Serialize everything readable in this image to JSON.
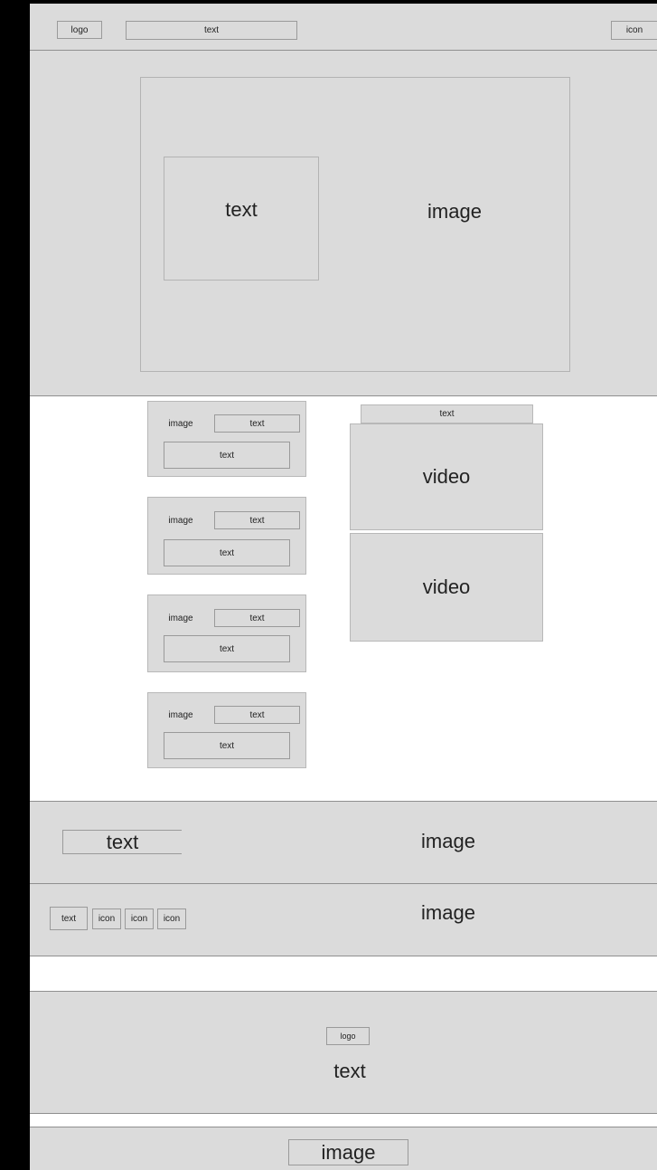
{
  "header": {
    "logo": "logo",
    "text": "text",
    "icon": "icon"
  },
  "hero": {
    "text": "text",
    "image": "image"
  },
  "cards": [
    {
      "image": "image",
      "tag": "text",
      "text": "text"
    },
    {
      "image": "image",
      "tag": "text",
      "text": "text"
    },
    {
      "image": "image",
      "tag": "text",
      "text": "text"
    },
    {
      "image": "image",
      "tag": "text",
      "text": "text"
    }
  ],
  "video_panel": {
    "title": "text",
    "videos": [
      "video",
      "video"
    ]
  },
  "banner": {
    "text": "text",
    "image": "image"
  },
  "social": {
    "text": "text",
    "icons": [
      "icon",
      "icon",
      "icon"
    ],
    "image": "image"
  },
  "footer": {
    "logo": "logo",
    "text": "text"
  },
  "bottom": {
    "image": "image"
  }
}
